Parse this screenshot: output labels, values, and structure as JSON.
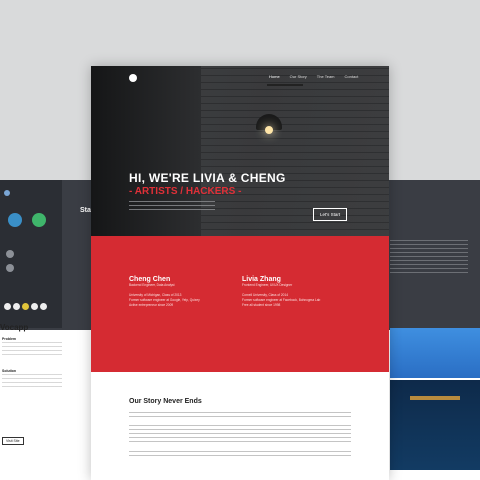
{
  "hero": {
    "nav": [
      "Home",
      "Our Story",
      "The Team",
      "Contact"
    ],
    "title": "HI, WE'RE LIVIA & CHENG",
    "subtitle": "- ARTISTS / HACKERS -",
    "cta": "Let's Start"
  },
  "bios": [
    {
      "name": "Cheng Chen",
      "role": "Backend Engineer, Data Analyst",
      "lines": [
        "University of Michigan, Class of 2013",
        "Former software engineer at Google, Yelp, Quixey",
        "Active entrepreneur since 2009"
      ]
    },
    {
      "name": "Livia Zhang",
      "role": "Frontend Engineer, UI/UX Designer",
      "lines": [
        "Cornell University, Class of 2014",
        "Former software engineer at Facebook, Bohnogma Lab",
        "Free all student since 1998"
      ]
    }
  ],
  "story": {
    "heading": "Our Story Never Ends"
  },
  "left_card": {
    "heading_partial": "Starr",
    "app_title": "Vocapp",
    "problem_label": "Problem",
    "solution_label": "Solution",
    "button": "Visit Site"
  },
  "colors": {
    "accent": "#d52b32",
    "hero_dark": "#2a2b2d"
  }
}
